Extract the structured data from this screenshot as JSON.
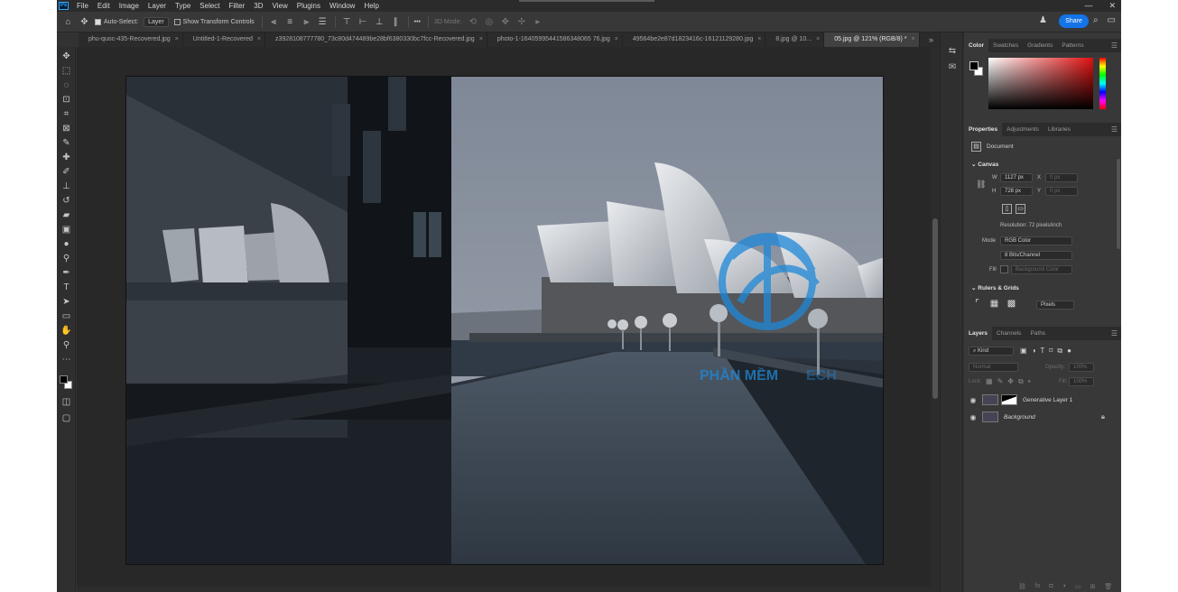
{
  "app": {
    "logo": "Ps"
  },
  "menu": [
    "File",
    "Edit",
    "Image",
    "Layer",
    "Type",
    "Select",
    "Filter",
    "3D",
    "View",
    "Plugins",
    "Window",
    "Help"
  ],
  "window_controls": {
    "minimize": "—",
    "close": "✕"
  },
  "options_bar": {
    "auto_select_label": "Auto-Select:",
    "auto_select_value": "Layer",
    "transform_controls_label": "Show Transform Controls",
    "more": "•••",
    "mode_3d": "3D Mode:",
    "share_label": "Share"
  },
  "tabs": [
    {
      "label": "phu-quoc-435-Recovered.jpg",
      "close": "×"
    },
    {
      "label": "Untitled-1-Recovered",
      "close": "×"
    },
    {
      "label": "z3928108777780_73c80d474489be28bf6380330bc7fcc-Recovered.jpg",
      "close": "×"
    },
    {
      "label": "photo-1-16405995441586348065 76.jpg",
      "close": "×"
    },
    {
      "label": "49564be2e87d1823416c-16121129280.jpg",
      "close": "×"
    },
    {
      "label": "8.jpg @ 10...",
      "close": "×"
    },
    {
      "label": "05.jpg @ 121% (RGB/8) *",
      "close": "×",
      "active": true
    }
  ],
  "tabs_more": "»",
  "tools": [
    "move-icon",
    "marquee-icon",
    "lasso-icon",
    "object-select-icon",
    "crop-icon",
    "frame-icon",
    "eyedropper-icon",
    "spot-heal-icon",
    "brush-icon",
    "stamp-icon",
    "history-brush-icon",
    "eraser-icon",
    "gradient-icon",
    "blur-icon",
    "dodge-icon",
    "pen-icon",
    "type-icon",
    "path-select-icon",
    "rectangle-icon",
    "hand-icon",
    "zoom-icon",
    "more-tools-icon"
  ],
  "watermark": {
    "text": "PHẦN MỀM",
    "text2": "ECH"
  },
  "color_panel": {
    "tabs": [
      "Color",
      "Swatches",
      "Gradients",
      "Patterns"
    ]
  },
  "properties_panel": {
    "tabs": [
      "Properties",
      "Adjustments",
      "Libraries"
    ],
    "doc_label": "Document",
    "canvas_title": "Canvas",
    "w_label": "W",
    "w_value": "1127 px",
    "h_label": "H",
    "h_value": "728 px",
    "x_label": "X",
    "x_value": "0 px",
    "y_label": "Y",
    "y_value": "0 px",
    "resolution": "Resolution: 72 pixels/inch",
    "mode_label": "Mode",
    "mode_value": "RGB Color",
    "depth_value": "8 Bits/Channel",
    "fill_label": "Fill",
    "fill_value": "Background Color",
    "rulers_title": "Rulers & Grids",
    "units_value": "Pixels"
  },
  "layers_panel": {
    "tabs": [
      "Layers",
      "Channels",
      "Paths"
    ],
    "kind_label": "Kind",
    "blend_mode": "Normal",
    "opacity_label": "Opacity:",
    "opacity_value": "100%",
    "lock_label": "Lock:",
    "fill_label": "Fill:",
    "fill_value": "100%",
    "layers": [
      {
        "name": "Generative Layer 1"
      },
      {
        "name": "Background"
      }
    ]
  }
}
